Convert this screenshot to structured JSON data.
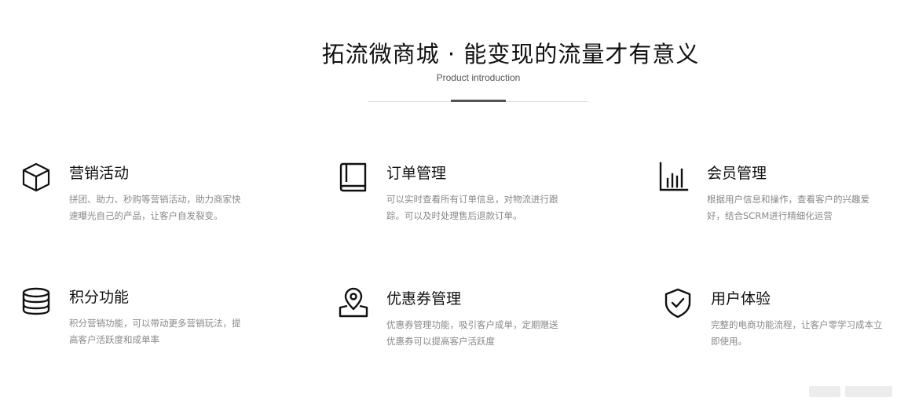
{
  "header": {
    "title": "拓流微商城 · 能变现的流量才有意义",
    "subtitle": "Product introduction"
  },
  "features": [
    {
      "icon": "cube-icon",
      "name": "营销活动",
      "desc": "拼团、助力、秒购等营销活动，助力商家快速曝光自己的产品，让客户自发裂变。"
    },
    {
      "icon": "book-icon",
      "name": "订单管理",
      "desc": "可以实时查看所有订单信息，对物流进行跟踪。可以及时处理售后退款订单。"
    },
    {
      "icon": "bar-chart-icon",
      "name": "会员管理",
      "desc": "根据用户信息和操作，查看客户的兴趣爱好，结合SCRM进行精细化运营"
    },
    {
      "icon": "database-icon",
      "name": "积分功能",
      "desc": "积分营销功能，可以带动更多营销玩法，提高客户活跃度和成单率"
    },
    {
      "icon": "map-pin-icon",
      "name": "优惠券管理",
      "desc": "优惠券管理功能，吸引客户成单，定期赠送优惠券可以提高客户活跃度"
    },
    {
      "icon": "shield-check-icon",
      "name": "用户体验",
      "desc": "完整的电商功能流程，让客户零学习成本立即使用。"
    }
  ]
}
